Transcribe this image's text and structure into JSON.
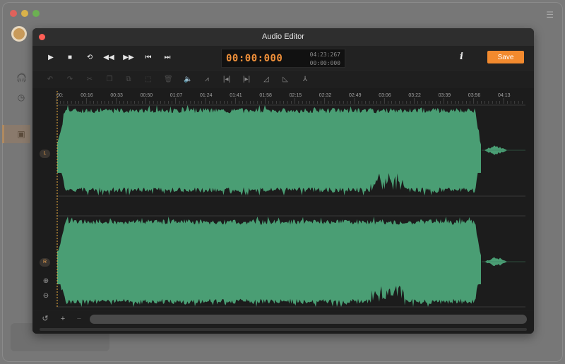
{
  "editor": {
    "title": "Audio Editor",
    "current_time": "00:00:000",
    "total_time": "04:23:267",
    "selection_time": "00:00:000",
    "info_label": "i",
    "save_label": "Save"
  },
  "channels": {
    "left": "L",
    "right": "R"
  },
  "timeline": {
    "ticks": [
      "00:",
      "00:16",
      "00:33",
      "00:50",
      "01:07",
      "01:24",
      "01:41",
      "01:58",
      "02:15",
      "02:32",
      "02:49",
      "03:06",
      "03:22",
      "03:39",
      "03:56",
      "04:13"
    ]
  },
  "colors": {
    "accent": "#f28a2e",
    "waveform": "#4a9e74",
    "time": "#f0903a"
  },
  "icons": {
    "transport": [
      "play-icon",
      "stop-icon",
      "loop-icon",
      "rewind-icon",
      "fast-forward-icon",
      "skip-start-icon",
      "skip-end-icon"
    ],
    "tools": [
      "undo-icon",
      "redo-icon",
      "cut-icon",
      "copy-icon",
      "paste-icon",
      "crop-icon",
      "delete-icon",
      "volume-icon",
      "amplify-icon",
      "trim-start-icon",
      "trim-end-icon",
      "fade-in-icon",
      "fade-out-icon",
      "effects-icon"
    ]
  }
}
